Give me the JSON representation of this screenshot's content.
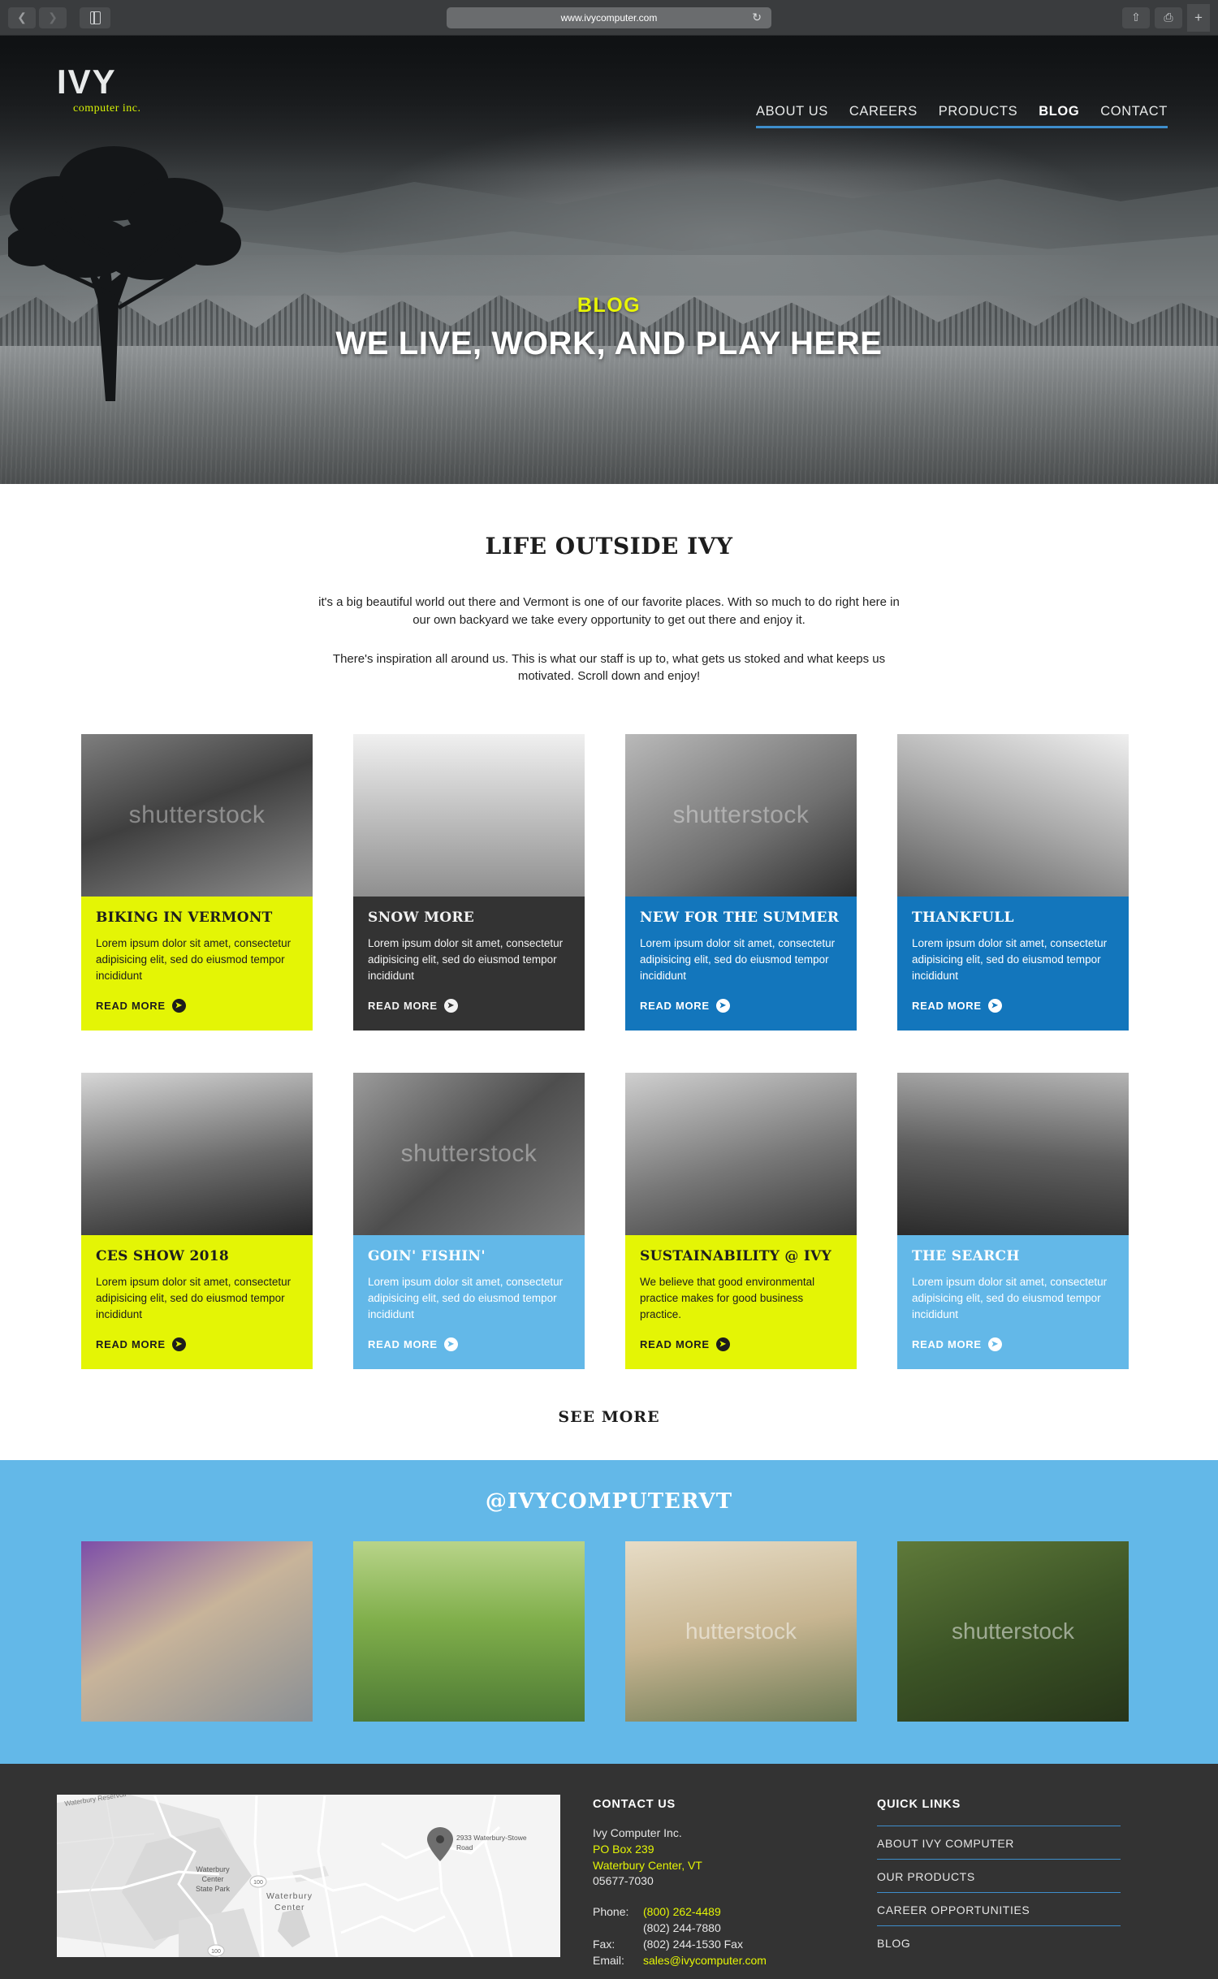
{
  "browser": {
    "url": "www.ivycomputer.com",
    "back_icon": "chevron-left-icon",
    "forward_icon": "chevron-right-icon",
    "sidebar_icon": "sidebar-icon",
    "reload_icon": "reload-icon",
    "share_icon": "share-icon",
    "tabs_icon": "tabs-icon",
    "new_tab_label": "+"
  },
  "header": {
    "brand_name": "IVY",
    "brand_tagline": "computer inc.",
    "nav": [
      {
        "label": "ABOUT US",
        "active": false
      },
      {
        "label": "CAREERS",
        "active": false
      },
      {
        "label": "PRODUCTS",
        "active": false
      },
      {
        "label": "BLOG",
        "active": true
      },
      {
        "label": "CONTACT",
        "active": false
      }
    ]
  },
  "hero": {
    "eyebrow": "BLOG",
    "title": "WE LIVE, WORK, AND PLAY HERE"
  },
  "intro": {
    "heading": "LIFE OUTSIDE IVY",
    "paragraph1": "it's a big beautiful world out there and Vermont is one of our favorite places. With so much to do right here in our own backyard we take every opportunity to get out there and enjoy it.",
    "paragraph2": "There's inspiration all around us. This is what our staff is up to, what gets us stoked and what keeps us motivated. Scroll down and enjoy!"
  },
  "cards": [
    {
      "title": "BIKING IN VERMONT",
      "desc": "Lorem ipsum dolor sit amet, consectetur adipisicing elit, sed do eiusmod tempor incididunt",
      "cta": "READ MORE",
      "theme": "t-lime",
      "watermark": "shutterstock"
    },
    {
      "title": "SNOW MORE",
      "desc": "Lorem ipsum dolor sit amet, consectetur adipisicing elit, sed do eiusmod tempor incididunt",
      "cta": "READ MORE",
      "theme": "t-dark",
      "watermark": ""
    },
    {
      "title": "NEW FOR THE SUMMER",
      "desc": "Lorem ipsum dolor sit amet, consectetur adipisicing elit, sed do eiusmod tempor incididunt",
      "cta": "READ MORE",
      "theme": "t-blue",
      "watermark": "shutterstock"
    },
    {
      "title": "THANKFULL",
      "desc": "Lorem ipsum dolor sit amet, consectetur adipisicing elit, sed do eiusmod tempor incididunt",
      "cta": "READ MORE",
      "theme": "t-blue",
      "watermark": ""
    },
    {
      "title": "CES SHOW 2018",
      "desc": "Lorem ipsum dolor sit amet, consectetur adipisicing elit, sed do eiusmod tempor incididunt",
      "cta": "READ MORE",
      "theme": "t-lime",
      "watermark": ""
    },
    {
      "title": "GOIN' FISHIN'",
      "desc": "Lorem ipsum dolor sit amet, consectetur adipisicing elit, sed do eiusmod tempor incididunt",
      "cta": "READ MORE",
      "theme": "t-lightblue",
      "watermark": "shutterstock"
    },
    {
      "title": "SUSTAINABILITY @ IVY",
      "desc": "We believe that good environmental practice makes for good business practice.",
      "cta": "READ MORE",
      "theme": "t-lime",
      "watermark": ""
    },
    {
      "title": "THE SEARCH",
      "desc": "Lorem ipsum dolor sit amet, consectetur adipisicing elit, sed do eiusmod tempor incididunt",
      "cta": "READ MORE",
      "theme": "t-lightblue",
      "watermark": ""
    }
  ],
  "see_more": {
    "label": "SEE MORE"
  },
  "instagram": {
    "handle": "@IVYCOMPUTERVT",
    "photos": [
      {
        "watermark": ""
      },
      {
        "watermark": ""
      },
      {
        "watermark": "hutterstock"
      },
      {
        "watermark": "shutterstock"
      }
    ]
  },
  "footer": {
    "contact_heading": "CONTACT US",
    "company": "Ivy Computer Inc.",
    "po_box": "PO Box 239",
    "city_state": "Waterbury Center, VT",
    "zip": "05677-7030",
    "phone_label": "Phone:",
    "phone1": "(800) 262-4489",
    "phone2": "(802) 244-7880",
    "fax_label": "Fax:",
    "fax": "(802) 244-1530 Fax",
    "email_label": "Email:",
    "email": "sales@ivycomputer.com",
    "quick_heading": "QUICK LINKS",
    "quick_links": [
      "ABOUT IVY COMPUTER",
      "OUR PRODUCTS",
      "CAREER OPPORTUNITIES",
      "BLOG"
    ],
    "map": {
      "pin_label": "2933 Waterbury-Stowe Road",
      "reservoir": "Waterbury Reservoir",
      "state_park_l1": "Waterbury",
      "state_park_l2": "Center",
      "state_park_l3": "State Park",
      "town_l1": "Waterbury",
      "town_l2": "Center",
      "route": "100",
      "route2": "100"
    }
  },
  "colors": {
    "lime": "#e4f505",
    "blue": "#1376bc",
    "light_blue": "#63b8e8",
    "dark": "#333333",
    "nav_underline": "#3e8ecc"
  }
}
